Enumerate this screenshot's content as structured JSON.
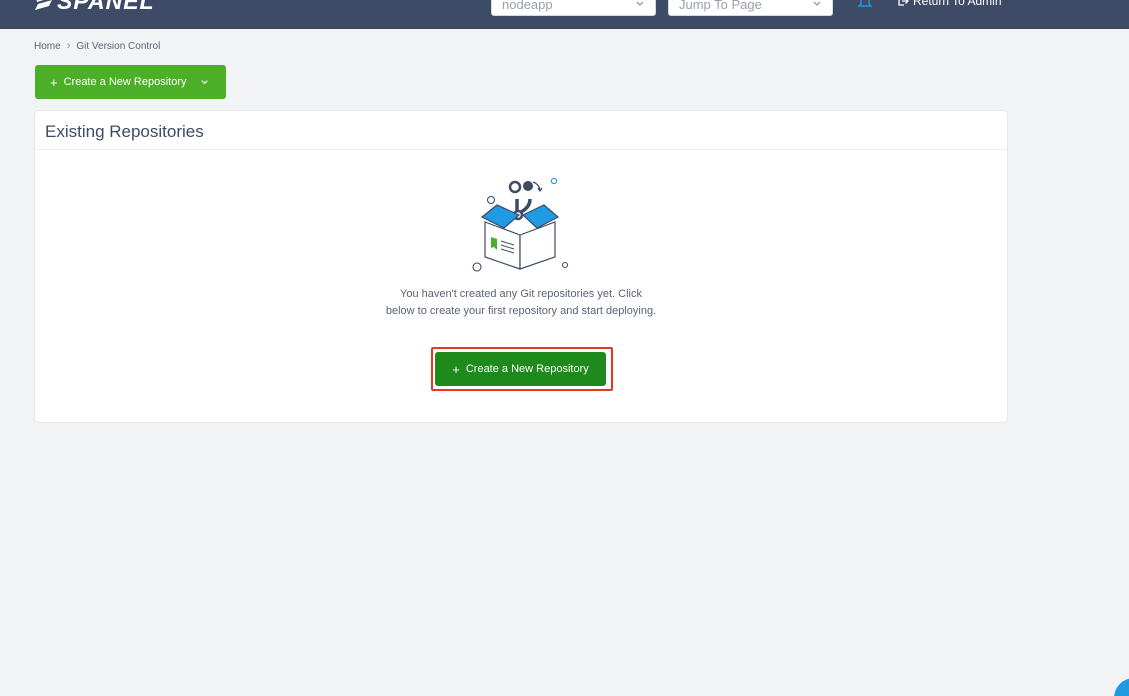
{
  "header": {
    "logo_text": "SPANEL",
    "account_select": {
      "value": "nodeapp"
    },
    "jump_select": {
      "placeholder": "Jump To Page"
    },
    "return_label": "Return To Admin"
  },
  "breadcrumb": {
    "home": "Home",
    "current": "Git Version Control"
  },
  "toolbar": {
    "create_label": "Create a New Repository"
  },
  "repositories": {
    "title": "Existing Repositories",
    "empty_message": "You haven't created any Git repositories yet. Click below to create your first repository and start deploying.",
    "create_label": "Create a New Repository"
  },
  "colors": {
    "topbar": "#3d4b66",
    "primary_green": "#4caf28",
    "dark_green": "#1f8a1c",
    "highlight": "#e33a1f",
    "accent_blue": "#1e9be2"
  },
  "icons": [
    "logo-mark-icon",
    "chevron-down-icon",
    "bell-icon",
    "sign-out-icon",
    "plus-icon",
    "git-box-illustration"
  ]
}
